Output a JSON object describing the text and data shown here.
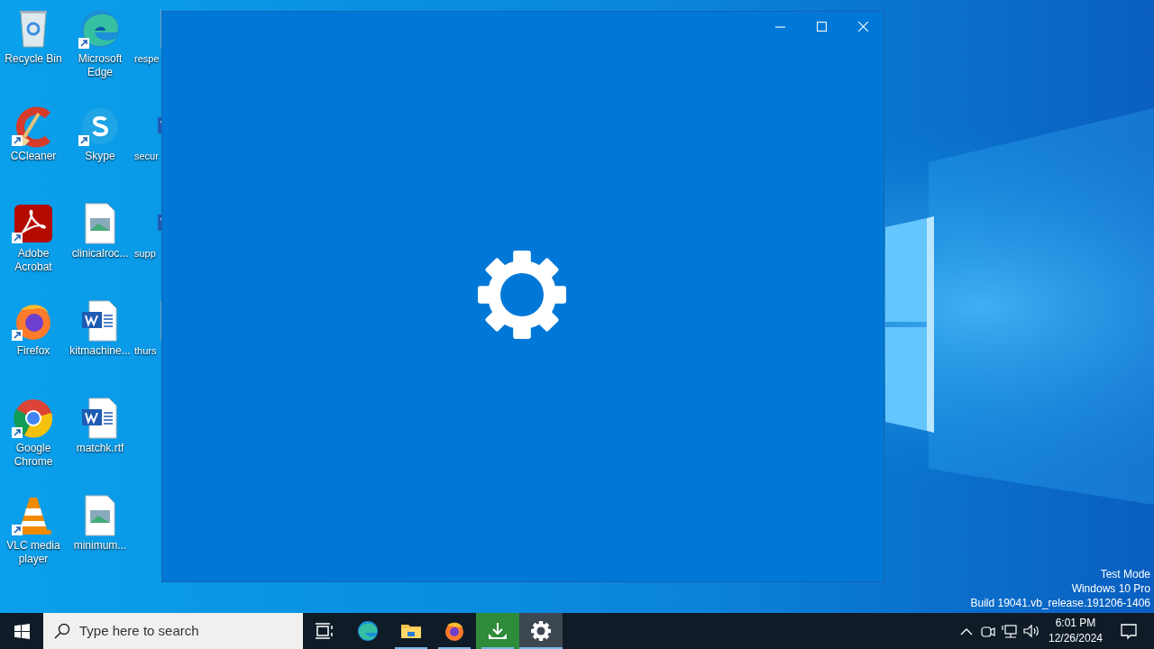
{
  "desktop_icons": [
    {
      "kind": "recycle",
      "label": "Recycle Bin",
      "shortcut": false,
      "cut": false
    },
    {
      "kind": "ccleaner",
      "label": "CCleaner",
      "shortcut": true,
      "cut": false
    },
    {
      "kind": "acrobat",
      "label": "Adobe Acrobat",
      "shortcut": true,
      "cut": false
    },
    {
      "kind": "firefox",
      "label": "Firefox",
      "shortcut": true,
      "cut": false
    },
    {
      "kind": "chrome",
      "label": "Google Chrome",
      "shortcut": true,
      "cut": false
    },
    {
      "kind": "vlc",
      "label": "VLC media player",
      "shortcut": true,
      "cut": false
    },
    {
      "kind": "edge",
      "label": "Microsoft Edge",
      "shortcut": true,
      "cut": false
    },
    {
      "kind": "skype",
      "label": "Skype",
      "shortcut": true,
      "cut": false
    },
    {
      "kind": "image",
      "label": "clinicalroc...",
      "shortcut": false,
      "cut": false
    },
    {
      "kind": "word",
      "label": "kitmachine...",
      "shortcut": false,
      "cut": false
    },
    {
      "kind": "word",
      "label": "matchk.rtf",
      "shortcut": false,
      "cut": false
    },
    {
      "kind": "image",
      "label": "minimum...",
      "shortcut": false,
      "cut": false
    },
    {
      "kind": "image",
      "label": "respe",
      "shortcut": false,
      "cut": true
    },
    {
      "kind": "word",
      "label": "secur",
      "shortcut": false,
      "cut": true
    },
    {
      "kind": "word",
      "label": "supp",
      "shortcut": false,
      "cut": true
    },
    {
      "kind": "image",
      "label": "thurs",
      "shortcut": false,
      "cut": true
    }
  ],
  "window": {
    "kind": "settings",
    "controls": [
      {
        "kind": "minimize"
      },
      {
        "kind": "maximize"
      },
      {
        "kind": "close"
      }
    ]
  },
  "watermark_text": [
    "Test Mode",
    "Windows 10 Pro",
    "Build 19041.vb_release.191206-1406"
  ],
  "taskbar": {
    "search": {
      "placeholder": "Type here to search"
    },
    "apps": [
      {
        "kind": "taskview",
        "running": false,
        "selected": false
      },
      {
        "kind": "edge",
        "running": false,
        "selected": false
      },
      {
        "kind": "explorer",
        "running": true,
        "selected": false
      },
      {
        "kind": "firefox",
        "running": true,
        "selected": false
      },
      {
        "kind": "installer",
        "running": true,
        "selected": false
      },
      {
        "kind": "settings",
        "running": true,
        "selected": true
      }
    ],
    "tray": [
      {
        "kind": "chevron"
      },
      {
        "kind": "meet"
      },
      {
        "kind": "network"
      },
      {
        "kind": "volume"
      }
    ],
    "time": "6:01 PM",
    "date": "12/26/2024"
  }
}
